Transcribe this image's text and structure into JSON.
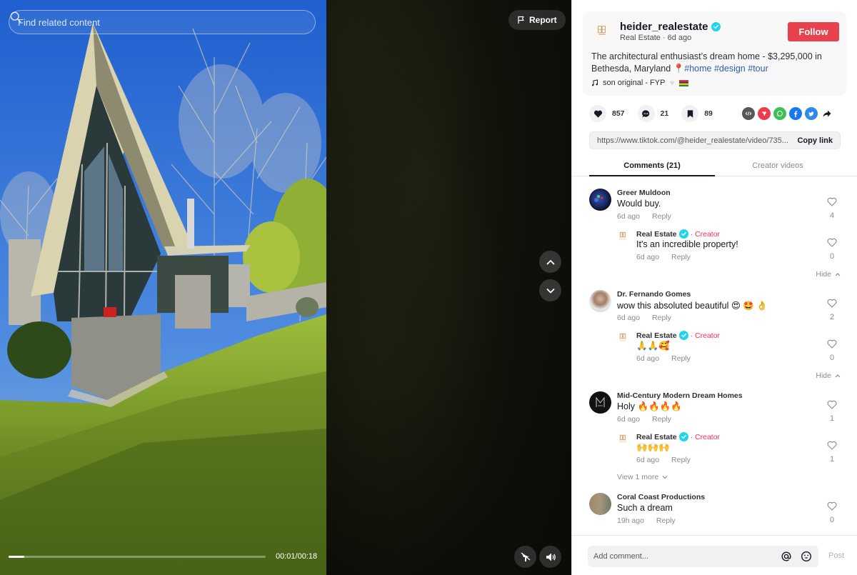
{
  "video": {
    "search_placeholder": "Find related content",
    "report_label": "Report",
    "progress_fraction": 0.06,
    "time_display": "00:01/00:18",
    "nav": {
      "up_label": "previous-video",
      "down_label": "next-video"
    },
    "controls": {
      "floating_player": "floating-player",
      "volume": "volume"
    }
  },
  "author": {
    "username": "heider_realestate",
    "verified": true,
    "category": "Real Estate",
    "posted": "6d ago",
    "subline": "Real Estate · 6d ago",
    "follow_label": "Follow"
  },
  "post": {
    "caption_text": "The architectural enthusiast’s dream home - $3,295,000 in Bethesda, Maryland",
    "caption_emoji": "📍",
    "hashtags": [
      "#home",
      "#design",
      "#tour"
    ],
    "music": "son original - FYP"
  },
  "stats": {
    "likes": "857",
    "comments": "21",
    "saves": "89"
  },
  "share": {
    "targets": [
      "embed",
      "send-to-friends",
      "whatsapp",
      "facebook",
      "twitter",
      "more"
    ],
    "colors": {
      "embed": "#555759",
      "send": "#fe2c55",
      "whatsapp": "#25d366",
      "facebook": "#1877f2",
      "twitter": "#1da1f2"
    },
    "url": "https://www.tiktok.com/@heider_realestate/video/735...",
    "copy_label": "Copy link"
  },
  "tabs": [
    {
      "label": "Comments (21)",
      "active": true
    },
    {
      "label": "Creator videos",
      "active": false
    }
  ],
  "comments": [
    {
      "author": "Greer Muldoon",
      "text": "Would buy.",
      "time": "6d ago",
      "reply_label": "Reply",
      "likes": "4",
      "replies": [
        {
          "author": "Real Estate",
          "badge": "Creator",
          "text": "It's an incredible property!",
          "time": "6d ago",
          "reply_label": "Reply",
          "likes": "0"
        }
      ],
      "toggle_label": "Hide"
    },
    {
      "author": "Dr. Fernando Gomes",
      "text": "wow this absoluted beautiful 😍 🤩 👌",
      "time": "6d ago",
      "reply_label": "Reply",
      "likes": "2",
      "replies": [
        {
          "author": "Real Estate",
          "badge": "Creator",
          "text": "🙏🙏🥰",
          "time": "6d ago",
          "reply_label": "Reply",
          "likes": "0"
        }
      ],
      "toggle_label": "Hide"
    },
    {
      "author": "Mid-Century Modern Dream Homes",
      "text": "Holy 🔥🔥🔥🔥",
      "time": "6d ago",
      "reply_label": "Reply",
      "likes": "1",
      "replies": [
        {
          "author": "Real Estate",
          "badge": "Creator",
          "text": "🙌🙌🙌",
          "time": "6d ago",
          "reply_label": "Reply",
          "likes": "1"
        }
      ],
      "toggle_label": "View 1 more"
    },
    {
      "author": "Coral Coast Productions",
      "text": "Such a dream",
      "time": "19h ago",
      "reply_label": "Reply",
      "likes": "0",
      "replies": []
    }
  ],
  "composer": {
    "placeholder": "Add comment...",
    "post_label": "Post"
  }
}
